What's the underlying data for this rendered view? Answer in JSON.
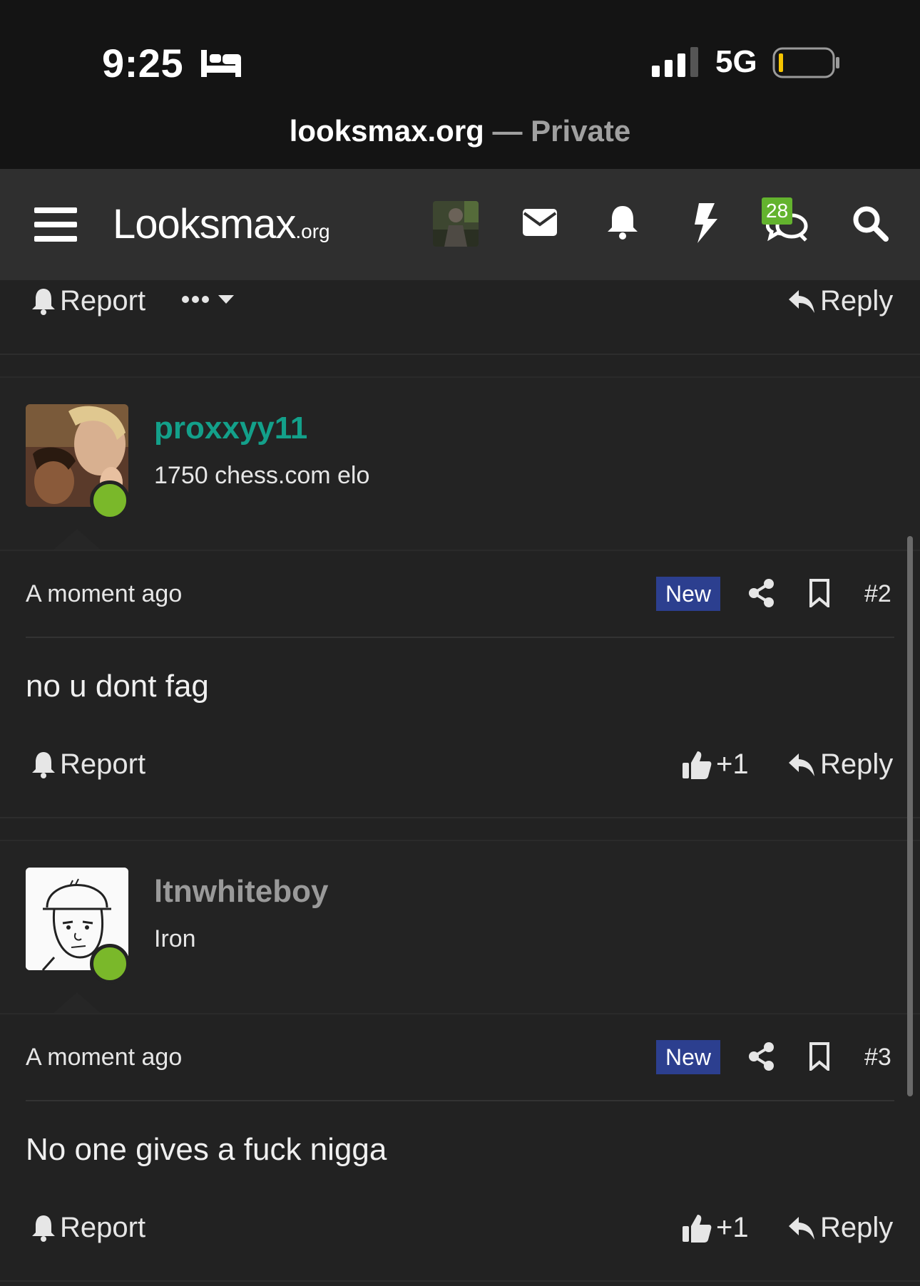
{
  "status": {
    "time": "9:25",
    "network": "5G"
  },
  "browser": {
    "host": "looksmax.org",
    "mode": " — Private"
  },
  "header": {
    "logo": "Looksmax",
    "logo_suffix": ".org",
    "chat_count": "28"
  },
  "top_actions": {
    "report": "Report",
    "reply": "Reply"
  },
  "posts": [
    {
      "username": "proxxyy11",
      "user_title": "1750 chess.com elo",
      "username_color": "#13a08a",
      "timestamp": "A moment ago",
      "badge": "New",
      "number": "#2",
      "content": "no u dont fag",
      "report": "Report",
      "reactions": "+1",
      "reply": "Reply"
    },
    {
      "username": "ltnwhiteboy",
      "user_title": "Iron",
      "username_color": "#9a9a9a",
      "timestamp": "A moment ago",
      "badge": "New",
      "number": "#3",
      "content": "No one gives a fuck nigga",
      "report": "Report",
      "reactions": "+1",
      "reply": "Reply"
    }
  ]
}
